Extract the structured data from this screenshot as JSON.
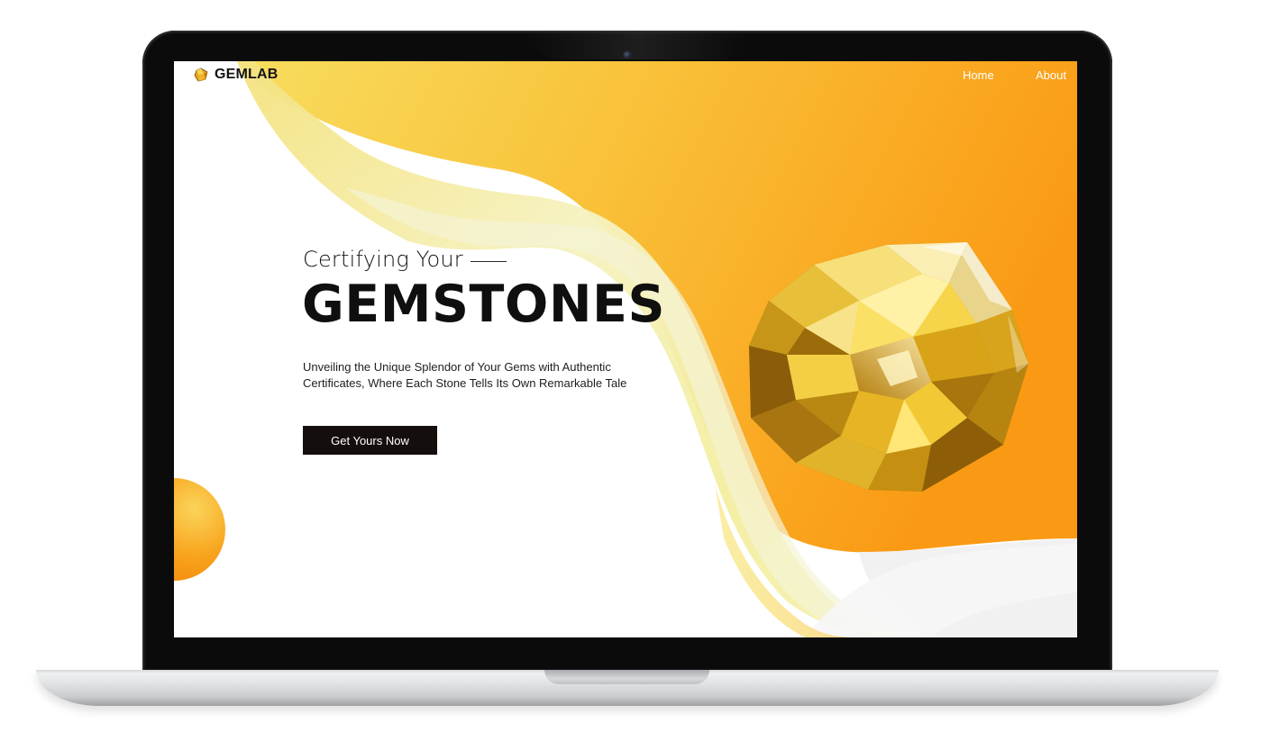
{
  "brand": {
    "name": "GEMLAB",
    "logo_icon": "gem-logo-icon"
  },
  "nav": {
    "items": [
      {
        "label": "Home"
      },
      {
        "label": "About"
      }
    ]
  },
  "hero": {
    "kicker": "Certifying Your",
    "headline": "GEMSTONES",
    "description": "Unveiling the Unique Splendor of Your Gems with Authentic Certificates, Where Each Stone Tells Its Own Remarkable Tale",
    "cta_label": "Get Yours Now",
    "image_icon": "yellow-gemstone-image"
  },
  "colors": {
    "accent_orange": "#f99a12",
    "accent_yellow": "#f5e07a",
    "button_bg": "#140f0d",
    "text_dark": "#0f0f0f"
  }
}
